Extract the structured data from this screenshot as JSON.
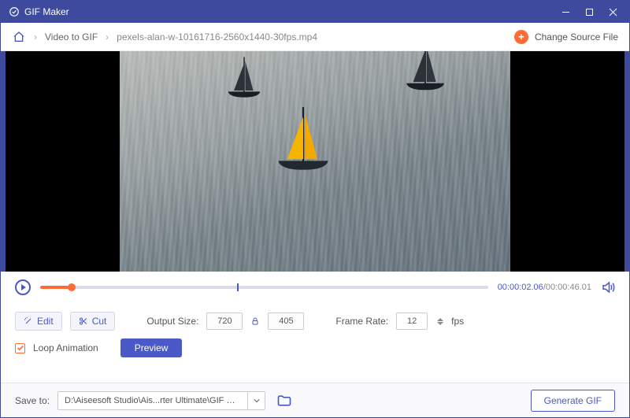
{
  "app": {
    "title": "GIF Maker"
  },
  "breadcrumb": {
    "step": "Video to GIF",
    "file": "pexels-alan-w-10161716-2560x1440-30fps.mp4",
    "change_source": "Change Source File"
  },
  "playback": {
    "current": "00:00:02.06",
    "total": "00:00:46.01"
  },
  "tools": {
    "edit": "Edit",
    "cut": "Cut",
    "output_size_label": "Output Size:",
    "width": "720",
    "height": "405",
    "frame_rate_label": "Frame Rate:",
    "frame_rate": "12",
    "fps": "fps",
    "loop": "Loop Animation",
    "preview": "Preview"
  },
  "footer": {
    "save_to_label": "Save to:",
    "path": "D:\\Aiseesoft Studio\\Ais...rter Ultimate\\GIF Maker",
    "generate": "Generate GIF"
  }
}
